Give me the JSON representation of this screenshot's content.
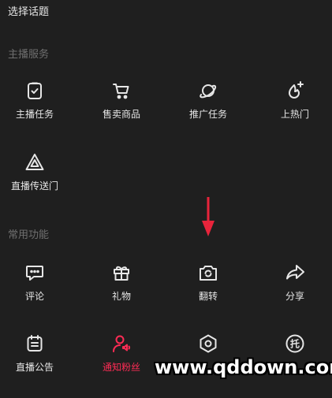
{
  "top_item": "选择话题",
  "sections": {
    "host_services": {
      "title": "主播服务",
      "items": [
        {
          "label": "主播任务",
          "icon": "task-clipboard-icon"
        },
        {
          "label": "售卖商品",
          "icon": "shopping-cart-icon"
        },
        {
          "label": "推广任务",
          "icon": "planet-icon"
        },
        {
          "label": "上热门",
          "icon": "flame-plus-icon"
        },
        {
          "label": "直播传送门",
          "icon": "triangle-portal-icon"
        }
      ]
    },
    "common_functions": {
      "title": "常用功能",
      "items": [
        {
          "label": "评论",
          "icon": "comment-icon"
        },
        {
          "label": "礼物",
          "icon": "gift-icon"
        },
        {
          "label": "翻转",
          "icon": "camera-flip-icon"
        },
        {
          "label": "分享",
          "icon": "share-arrow-icon"
        },
        {
          "label": "直播公告",
          "icon": "announcement-icon"
        },
        {
          "label": "通知粉丝",
          "icon": "notify-fans-icon"
        },
        {
          "label": "",
          "icon": "settings-hexagon-icon"
        },
        {
          "label": "",
          "icon": "tuo-icon"
        }
      ]
    }
  },
  "watermark": "www.qddown.com",
  "colors": {
    "background": "#1f1f1f",
    "text": "#e6e6e6",
    "section_title": "#6f6f6f",
    "accent": "#fe2c55",
    "arrow": "#e8243b"
  }
}
